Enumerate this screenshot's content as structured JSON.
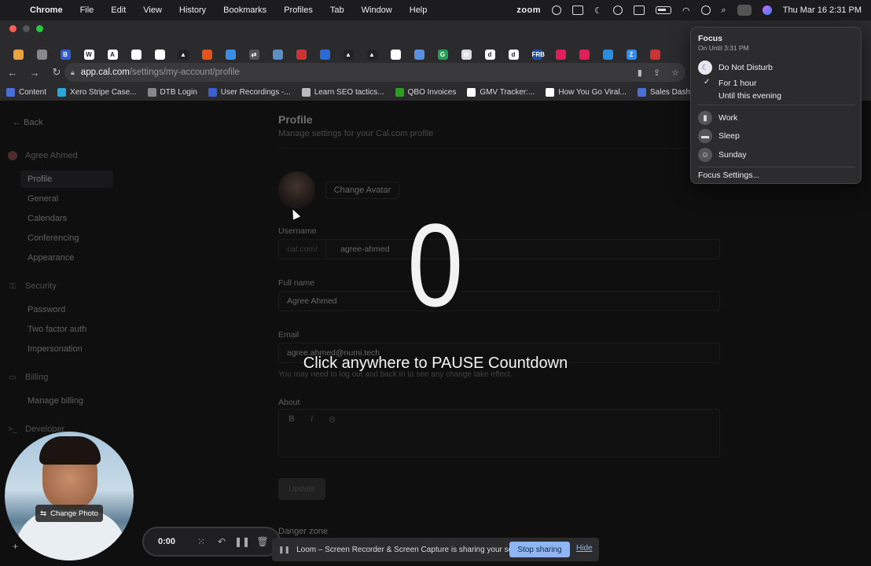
{
  "menubar": {
    "apple": "",
    "items": [
      "Chrome",
      "File",
      "Edit",
      "View",
      "History",
      "Bookmarks",
      "Profiles",
      "Tab",
      "Window",
      "Help"
    ],
    "zoom": "zoom",
    "clock": "Thu Mar 16  2:31 PM"
  },
  "browser": {
    "url_host": "app.cal.com",
    "url_path": "/settings/my-account/profile",
    "bookmarks": [
      {
        "label": "Content",
        "color": "#4a6fd8"
      },
      {
        "label": "Xero Stripe Case...",
        "color": "#2aa6de"
      },
      {
        "label": "DTB Login",
        "color": "#888888"
      },
      {
        "label": "User Recordings -...",
        "color": "#3a5fd9"
      },
      {
        "label": "Learn SEO tactics...",
        "color": "#bbbbbb"
      },
      {
        "label": "QBO Invoices",
        "color": "#2ca01c"
      },
      {
        "label": "GMV Tracker:...",
        "color": "#ffffff"
      },
      {
        "label": "How You Go Viral...",
        "color": "#ffffff"
      },
      {
        "label": "Sales Dashboard:...",
        "color": "#4a6fd8"
      }
    ],
    "tab_favicons": [
      {
        "c": "#e8a33a",
        "t": ""
      },
      {
        "c": "#888",
        "t": ""
      },
      {
        "c": "#2f5ad8",
        "t": "B"
      },
      {
        "c": "#ffffff",
        "t": "W"
      },
      {
        "c": "#ffffff",
        "t": "A"
      },
      {
        "c": "#ffffff",
        "t": ""
      },
      {
        "c": "#ffffff",
        "t": ""
      },
      {
        "c": "#222",
        "t": "▲"
      },
      {
        "c": "#e5531a",
        "t": ""
      },
      {
        "c": "#3b8ee8",
        "t": ""
      },
      {
        "c": "#555",
        "t": "⇄"
      },
      {
        "c": "#5a8fc7",
        "t": ""
      },
      {
        "c": "#c33",
        "t": ""
      },
      {
        "c": "#2a6bd8",
        "t": ""
      },
      {
        "c": "#222",
        "t": "▲"
      },
      {
        "c": "#222",
        "t": "▲"
      },
      {
        "c": "#ffffff",
        "t": ""
      },
      {
        "c": "#5b8fe0",
        "t": ""
      },
      {
        "c": "#1fa15a",
        "t": "G"
      },
      {
        "c": "#ddd",
        "t": "⊖"
      },
      {
        "c": "#ffffff",
        "t": "d"
      },
      {
        "c": "#ffffff",
        "t": "d"
      },
      {
        "c": "#1d4ea8",
        "t": "FRB"
      },
      {
        "c": "#e01e5a",
        "t": ""
      },
      {
        "c": "#e01e5a",
        "t": ""
      },
      {
        "c": "#2b8de0",
        "t": ""
      },
      {
        "c": "#2d8cff",
        "t": "Z"
      },
      {
        "c": "#cc3333",
        "t": ""
      }
    ]
  },
  "sidebar": {
    "back": "Back",
    "account_name": "Agree Ahmed",
    "account_items": [
      "Profile",
      "General",
      "Calendars",
      "Conferencing",
      "Appearance"
    ],
    "security_label": "Security",
    "security_items": [
      "Password",
      "Two factor auth",
      "Impersonation"
    ],
    "billing_label": "Billing",
    "billing_items": [
      "Manage billing"
    ],
    "developer_label": "Developer"
  },
  "profile": {
    "title": "Profile",
    "subtitle": "Manage settings for your Cal.com profile",
    "change_avatar": "Change Avatar",
    "username_label": "Username",
    "username_prefix": "cal.com/",
    "username_value": "agree-ahmed",
    "fullname_label": "Full name",
    "fullname_value": "Agree Ahmed",
    "email_label": "Email",
    "email_value": "agree.ahmed@numi.tech",
    "email_hint": "You may need to log out and back in to see any change take effect.",
    "about_label": "About",
    "editor_tools": [
      "B",
      "I",
      "⊝"
    ],
    "update_button": "Update",
    "danger_zone": "Danger zone"
  },
  "countdown": {
    "number": "0",
    "hint": "Click anywhere to PAUSE Countdown"
  },
  "focus_menu": {
    "title": "Focus",
    "subtitle": "On Until 3:31 PM",
    "dnd": "Do Not Disturb",
    "for_1_hour": "For 1 hour",
    "until_evening": "Until this evening",
    "work": "Work",
    "sleep": "Sleep",
    "sunday": "Sunday",
    "settings": "Focus Settings..."
  },
  "loom": {
    "change_photo": "Change Photo",
    "timer": "0:00",
    "sharing_text": "Loom – Screen Recorder & Screen Capture is sharing your screen.",
    "stop_sharing": "Stop sharing",
    "hide": "Hide"
  }
}
